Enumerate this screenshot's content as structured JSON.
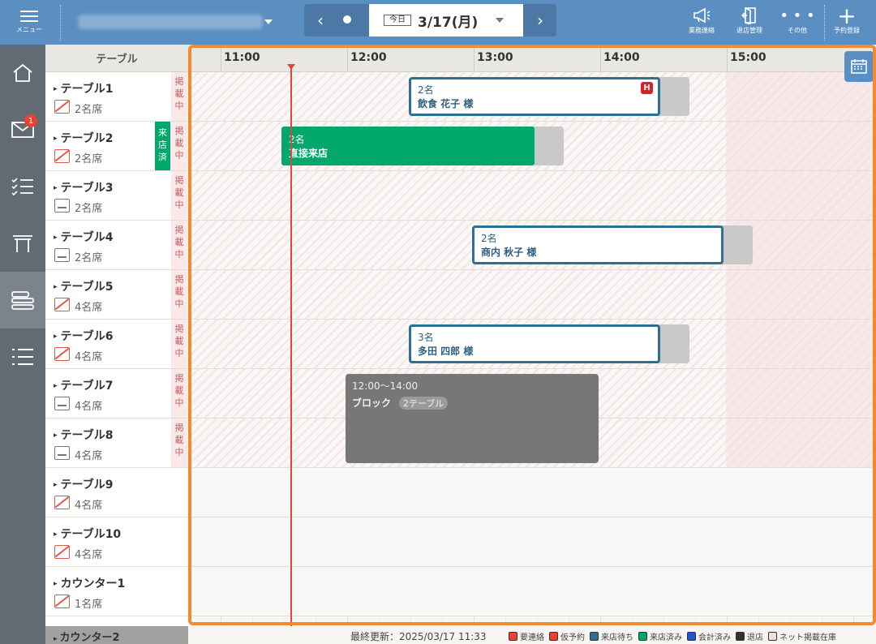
{
  "header": {
    "menu_label": "メニュー",
    "date": "3/17(月)",
    "today_label": "今日",
    "actions": [
      {
        "label": "業務連絡",
        "icon": "megaphone-icon"
      },
      {
        "label": "退店管理",
        "icon": "exit-door-icon"
      },
      {
        "label": "その他",
        "icon": "more-dots-icon"
      },
      {
        "label": "予約登録",
        "icon": "plus-icon"
      }
    ]
  },
  "rail": {
    "mail_badge": "1",
    "items": [
      "home-icon",
      "mail-icon",
      "checklist-icon",
      "table-icon",
      "timeline-icon",
      "list-icon"
    ]
  },
  "table_header": "テーブル",
  "tables": [
    {
      "name": "テーブル1",
      "seats": "2名席",
      "listed": "掲載中",
      "smoking": false
    },
    {
      "name": "テーブル2",
      "seats": "2名席",
      "listed": "掲載中",
      "smoking": false,
      "status": "来店済"
    },
    {
      "name": "テーブル3",
      "seats": "2名席",
      "listed": "掲載中",
      "smoking": true
    },
    {
      "name": "テーブル4",
      "seats": "2名席",
      "listed": "掲載中",
      "smoking": true
    },
    {
      "name": "テーブル5",
      "seats": "4名席",
      "listed": "掲載中",
      "smoking": false
    },
    {
      "name": "テーブル6",
      "seats": "4名席",
      "listed": "掲載中",
      "smoking": false
    },
    {
      "name": "テーブル7",
      "seats": "4名席",
      "listed": "掲載中",
      "smoking": true
    },
    {
      "name": "テーブル8",
      "seats": "4名席",
      "listed": "掲載中",
      "smoking": true
    },
    {
      "name": "テーブル9",
      "seats": "4名席",
      "smoking": false
    },
    {
      "name": "テーブル10",
      "seats": "4名席",
      "smoking": false
    },
    {
      "name": "カウンター1",
      "seats": "1名席",
      "smoking": false
    }
  ],
  "last_row": "カウンター2",
  "times": [
    "11:00",
    "12:00",
    "13:00",
    "14:00",
    "15:00"
  ],
  "reservations": [
    {
      "row": 0,
      "count": "2名",
      "name": "飲食 花子 様",
      "hotpepper": "H"
    },
    {
      "row": 1,
      "count": "2名",
      "name": "直接来店",
      "walkin": true
    },
    {
      "row": 3,
      "count": "2名",
      "name": "商内 秋子 様"
    },
    {
      "row": 5,
      "count": "3名",
      "name": "多田 四郎 様"
    }
  ],
  "block": {
    "time": "12:00～14:00",
    "label": "ブロック",
    "chip": "2テーブル"
  },
  "footer": {
    "updated": "最終更新：2025/03/17 11:33",
    "legend": [
      {
        "label": "要連絡",
        "color": "#e8432e"
      },
      {
        "label": "仮予約",
        "color": "#e8432e"
      },
      {
        "label": "来店待ち",
        "color": "#2f6f8f"
      },
      {
        "label": "来店済み",
        "color": "#00a86b"
      },
      {
        "label": "会計済み",
        "color": "#2155c9"
      },
      {
        "label": "退店",
        "color": "#333333"
      },
      {
        "label": "ネット掲載在庫",
        "color": "#f7dede"
      }
    ]
  },
  "colors": {
    "header": "#5b8fc2",
    "accent": "#f28a30",
    "now_line": "#e3443b"
  }
}
